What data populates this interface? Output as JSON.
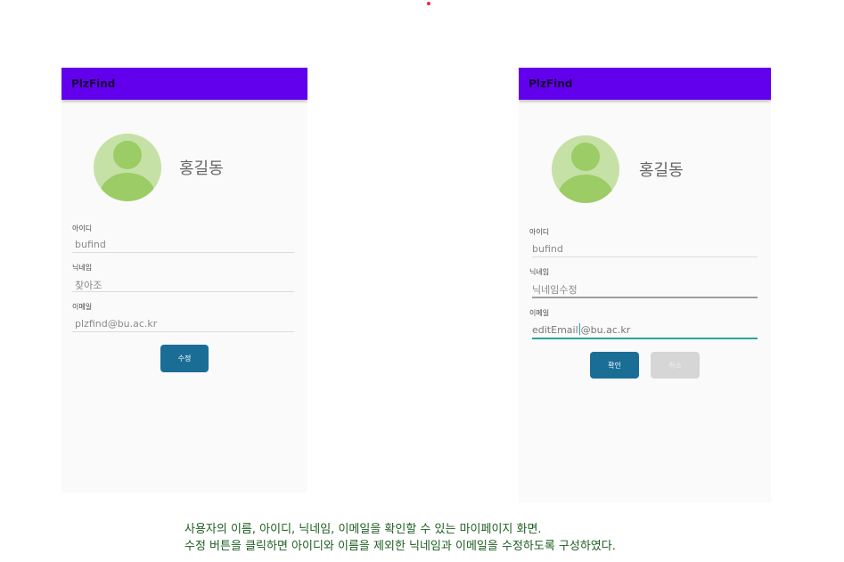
{
  "left_screen": {
    "app_title": "PlzFind",
    "user_name": "홍길동",
    "id_label": "아이디",
    "id_value": "bufind",
    "nickname_label": "닉네임",
    "nickname_value": "찾아조",
    "email_label": "이메일",
    "email_value": "plzfind@bu.ac.kr",
    "edit_button": "수정"
  },
  "right_screen": {
    "app_title": "PlzFind",
    "user_name": "홍길동",
    "id_label": "아이디",
    "id_value": "bufind",
    "nickname_label": "닉네임",
    "nickname_placeholder": "닉네임수정",
    "email_label": "이메일",
    "email_value_before_cursor": "editEmail",
    "email_value_after_cursor": "@bu.ac.kr",
    "confirm_button": "확인",
    "cancel_button": "취소"
  },
  "caption": {
    "line1": "사용자의 이름, 아이디, 닉네임, 이메일을 확인할 수 있는 마이페이지 화면.",
    "line2": "수정 버튼을 클릭하면 아이디와 이름을 제외한 닉네임과 이메일을 수정하도록 구성하였다."
  },
  "colors": {
    "app_bar": "#6200ee",
    "primary_button": "#1a6e96",
    "disabled_button": "#d6d6d6",
    "avatar_light": "#c5e1a5",
    "avatar_dark": "#9ccc65",
    "focus_underline": "#26a69a",
    "caption_text": "#1d5e20"
  }
}
